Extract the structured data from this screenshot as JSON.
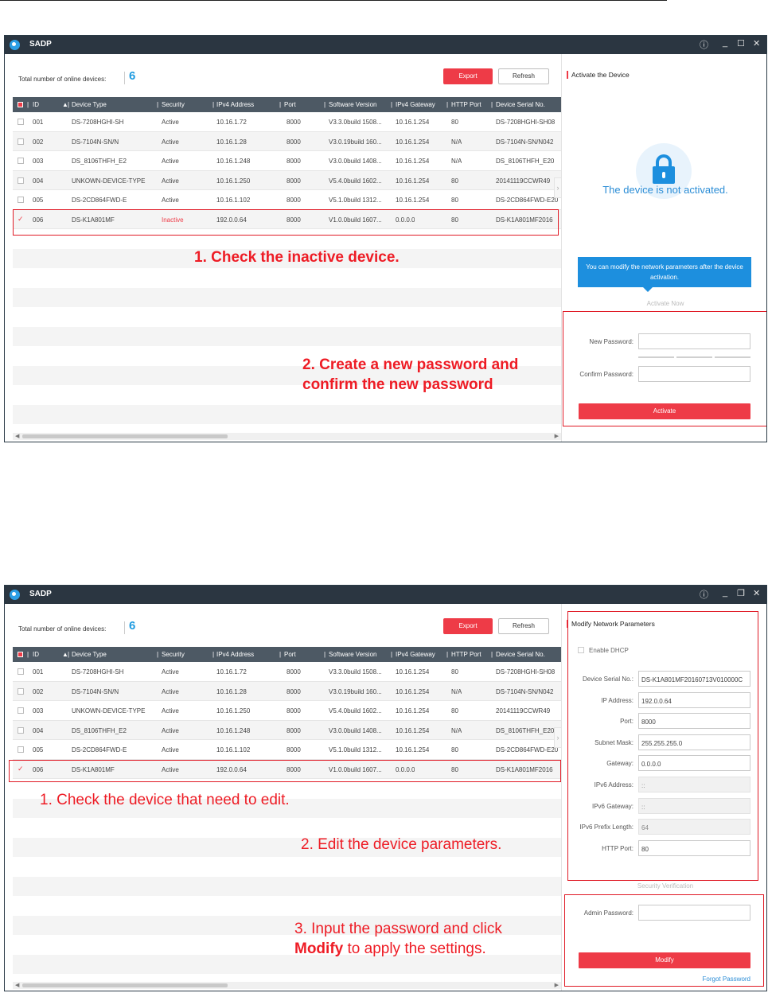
{
  "app_title": "SADP",
  "window_controls": {
    "info": "ⓘ",
    "minimize": "_",
    "maximize": "☐",
    "restore": "❐",
    "close": "✕"
  },
  "device_count_label": "Total number of online devices:",
  "device_count": "6",
  "buttons": {
    "export": "Export",
    "refresh": "Refresh"
  },
  "columns": [
    "ID",
    "Device Type",
    "Security",
    "IPv4 Address",
    "Port",
    "Software Version",
    "IPv4 Gateway",
    "HTTP Port",
    "Device Serial No."
  ],
  "sort_indicator": "▲",
  "screen1": {
    "rows": [
      {
        "id": "001",
        "type": "DS-7208HGHI-SH",
        "security": "Active",
        "ip": "10.16.1.72",
        "port": "8000",
        "sw": "V3.3.0build 1508...",
        "gw": "10.16.1.254",
        "http": "80",
        "serial": "DS-7208HGHI-SH08"
      },
      {
        "id": "002",
        "type": "DS-7104N-SN/N",
        "security": "Active",
        "ip": "10.16.1.28",
        "port": "8000",
        "sw": "V3.0.19build 160...",
        "gw": "10.16.1.254",
        "http": "N/A",
        "serial": "DS-7104N-SN/N042"
      },
      {
        "id": "003",
        "type": "DS_8106THFH_E2",
        "security": "Active",
        "ip": "10.16.1.248",
        "port": "8000",
        "sw": "V3.0.0build 1408...",
        "gw": "10.16.1.254",
        "http": "N/A",
        "serial": "DS_8106THFH_E20"
      },
      {
        "id": "004",
        "type": "UNKOWN-DEVICE-TYPE",
        "security": "Active",
        "ip": "10.16.1.250",
        "port": "8000",
        "sw": "V5.4.0build 1602...",
        "gw": "10.16.1.254",
        "http": "80",
        "serial": "20141119CCWR49"
      },
      {
        "id": "005",
        "type": "DS-2CD864FWD-E",
        "security": "Active",
        "ip": "10.16.1.102",
        "port": "8000",
        "sw": "V5.1.0build 1312...",
        "gw": "10.16.1.254",
        "http": "80",
        "serial": "DS-2CD864FWD-E20"
      },
      {
        "id": "006",
        "type": "DS-K1A801MF",
        "security": "Inactive",
        "ip": "192.0.0.64",
        "port": "8000",
        "sw": "V1.0.0build 1607...",
        "gw": "0.0.0.0",
        "http": "80",
        "serial": "DS-K1A801MF2016"
      }
    ],
    "annotation1": "1. Check the inactive device.",
    "annotation2_line1": "2. Create a new password and",
    "annotation2_line2": "confirm the new password",
    "panel": {
      "title": "Activate the Device",
      "status": "The device is not activated.",
      "tip": "You can modify the network parameters after the device activation.",
      "activate_now": "Activate Now",
      "new_password_label": "New Password:",
      "confirm_password_label": "Confirm Password:",
      "activate_button": "Activate"
    }
  },
  "screen2": {
    "rows": [
      {
        "id": "001",
        "type": "DS-7208HGHI-SH",
        "security": "Active",
        "ip": "10.16.1.72",
        "port": "8000",
        "sw": "V3.3.0build 1508...",
        "gw": "10.16.1.254",
        "http": "80",
        "serial": "DS-7208HGHI-SH08"
      },
      {
        "id": "002",
        "type": "DS-7104N-SN/N",
        "security": "Active",
        "ip": "10.16.1.28",
        "port": "8000",
        "sw": "V3.0.19build 160...",
        "gw": "10.16.1.254",
        "http": "N/A",
        "serial": "DS-7104N-SN/N042"
      },
      {
        "id": "003",
        "type": "UNKOWN-DEVICE-TYPE",
        "security": "Active",
        "ip": "10.16.1.250",
        "port": "8000",
        "sw": "V5.4.0build 1602...",
        "gw": "10.16.1.254",
        "http": "80",
        "serial": "20141119CCWR49"
      },
      {
        "id": "004",
        "type": "DS_8106THFH_E2",
        "security": "Active",
        "ip": "10.16.1.248",
        "port": "8000",
        "sw": "V3.0.0build 1408...",
        "gw": "10.16.1.254",
        "http": "N/A",
        "serial": "DS_8106THFH_E20"
      },
      {
        "id": "005",
        "type": "DS-2CD864FWD-E",
        "security": "Active",
        "ip": "10.16.1.102",
        "port": "8000",
        "sw": "V5.1.0build 1312...",
        "gw": "10.16.1.254",
        "http": "80",
        "serial": "DS-2CD864FWD-E20"
      },
      {
        "id": "006",
        "type": "DS-K1A801MF",
        "security": "Active",
        "ip": "192.0.0.64",
        "port": "8000",
        "sw": "V1.0.0build 1607...",
        "gw": "0.0.0.0",
        "http": "80",
        "serial": "DS-K1A801MF2016"
      }
    ],
    "annotation1": "1. Check the device that need to edit.",
    "annotation2": "2. Edit the device parameters.",
    "annotation3_line1": "3. Input the password and click",
    "annotation3_bold": "Modify",
    "annotation3_rest": " to apply the settings.",
    "panel": {
      "title": "Modify Network Parameters",
      "enable_dhcp": "Enable DHCP",
      "fields": [
        {
          "label": "Device Serial No.:",
          "value": "DS-K1A801MF20160713V010000C",
          "disabled": false
        },
        {
          "label": "IP Address:",
          "value": "192.0.0.64",
          "disabled": false
        },
        {
          "label": "Port:",
          "value": "8000",
          "disabled": false
        },
        {
          "label": "Subnet Mask:",
          "value": "255.255.255.0",
          "disabled": false
        },
        {
          "label": "Gateway:",
          "value": "0.0.0.0",
          "disabled": false
        },
        {
          "label": "IPv6 Address:",
          "value": "::",
          "disabled": true
        },
        {
          "label": "IPv6 Gateway:",
          "value": "::",
          "disabled": true
        },
        {
          "label": "IPv6 Prefix Length:",
          "value": "64",
          "disabled": true
        },
        {
          "label": "HTTP Port:",
          "value": "80",
          "disabled": false
        }
      ],
      "security_verification": "Security Verification",
      "admin_password_label": "Admin Password:",
      "modify_button": "Modify",
      "forgot_password": "Forgot Password"
    }
  },
  "colors": {
    "accent_red": "#ee3b47",
    "annotation_red": "#ee1c25",
    "blue": "#1d8fde",
    "titlebar": "#2b3641",
    "header": "#4d5964"
  }
}
